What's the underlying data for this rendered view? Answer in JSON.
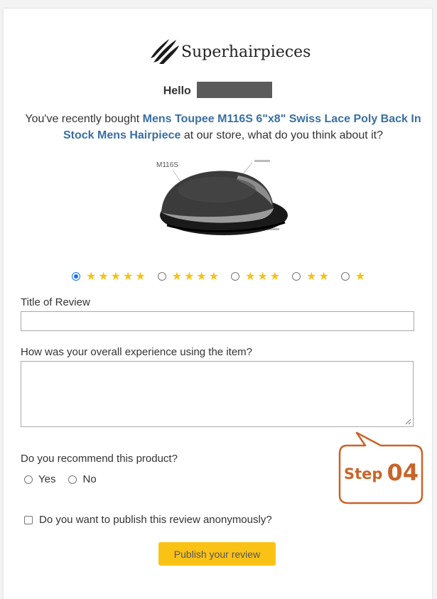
{
  "brand": {
    "name": "Superhairpieces"
  },
  "greeting": {
    "hello": "Hello"
  },
  "intro": {
    "prefix": "You've recently bought ",
    "product_name": "Mens Toupee M116S 6\"x8\" Swiss Lace Poly Back In Stock Mens Hairpiece",
    "suffix": " at our store, what do you think about it?"
  },
  "product_image": {
    "code_label": "M116S"
  },
  "rating": {
    "selected": 5,
    "options": [
      {
        "value": 5,
        "stars": "★★★★★"
      },
      {
        "value": 4,
        "stars": "★★★★"
      },
      {
        "value": 3,
        "stars": "★★★"
      },
      {
        "value": 2,
        "stars": "★★"
      },
      {
        "value": 1,
        "stars": "★"
      }
    ],
    "star_color": "#f3c317"
  },
  "form": {
    "title_label": "Title of Review",
    "title_value": "",
    "experience_label": "How was your overall experience using the item?",
    "experience_value": "",
    "recommend_label": "Do you recommend this product?",
    "recommend_yes": "Yes",
    "recommend_no": "No",
    "anonymous_label": "Do you want to publish this review anonymously?",
    "publish_label": "Publish your review"
  },
  "step": {
    "word": "Step",
    "number": "04",
    "color": "#c8652a"
  },
  "colors": {
    "link": "#3a6fa3",
    "button": "#fbc216"
  }
}
